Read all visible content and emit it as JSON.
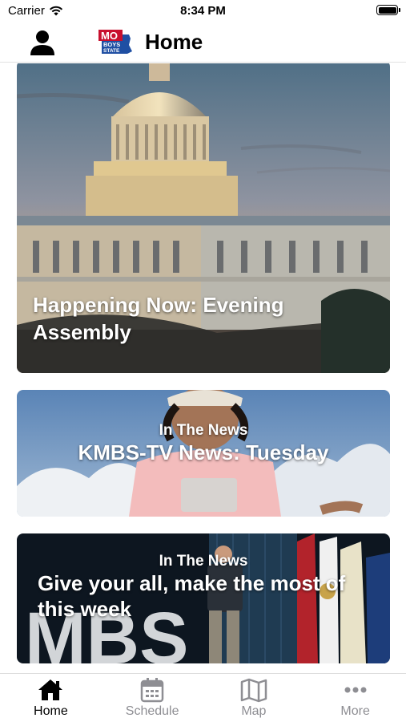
{
  "status_bar": {
    "carrier": "Carrier",
    "time": "8:34 PM"
  },
  "header": {
    "title": "Home",
    "logo_text_top": "MO",
    "logo_text_mid": "BOYS",
    "logo_text_bot": "STATE"
  },
  "feed": [
    {
      "category": "",
      "headline": "Happening Now: Evening Assembly",
      "image": "capitol-building-photo"
    },
    {
      "category": "In The News",
      "headline": "KMBS-TV News: Tuesday",
      "image": "student-speaker-photo"
    },
    {
      "category": "In The News",
      "headline": "Give your all, make the most of this week",
      "image": "stage-speaker-photo",
      "backdrop_letters": "MBS"
    }
  ],
  "tabs": [
    {
      "label": "Home",
      "icon": "home-icon",
      "active": true
    },
    {
      "label": "Schedule",
      "icon": "calendar-icon",
      "active": false
    },
    {
      "label": "Map",
      "icon": "map-icon",
      "active": false
    },
    {
      "label": "More",
      "icon": "more-dots-icon",
      "active": false
    }
  ],
  "colors": {
    "active_tab": "#000000",
    "inactive_tab": "#8e8e93",
    "logo_red": "#c8102e",
    "logo_blue": "#1f4fa3"
  }
}
